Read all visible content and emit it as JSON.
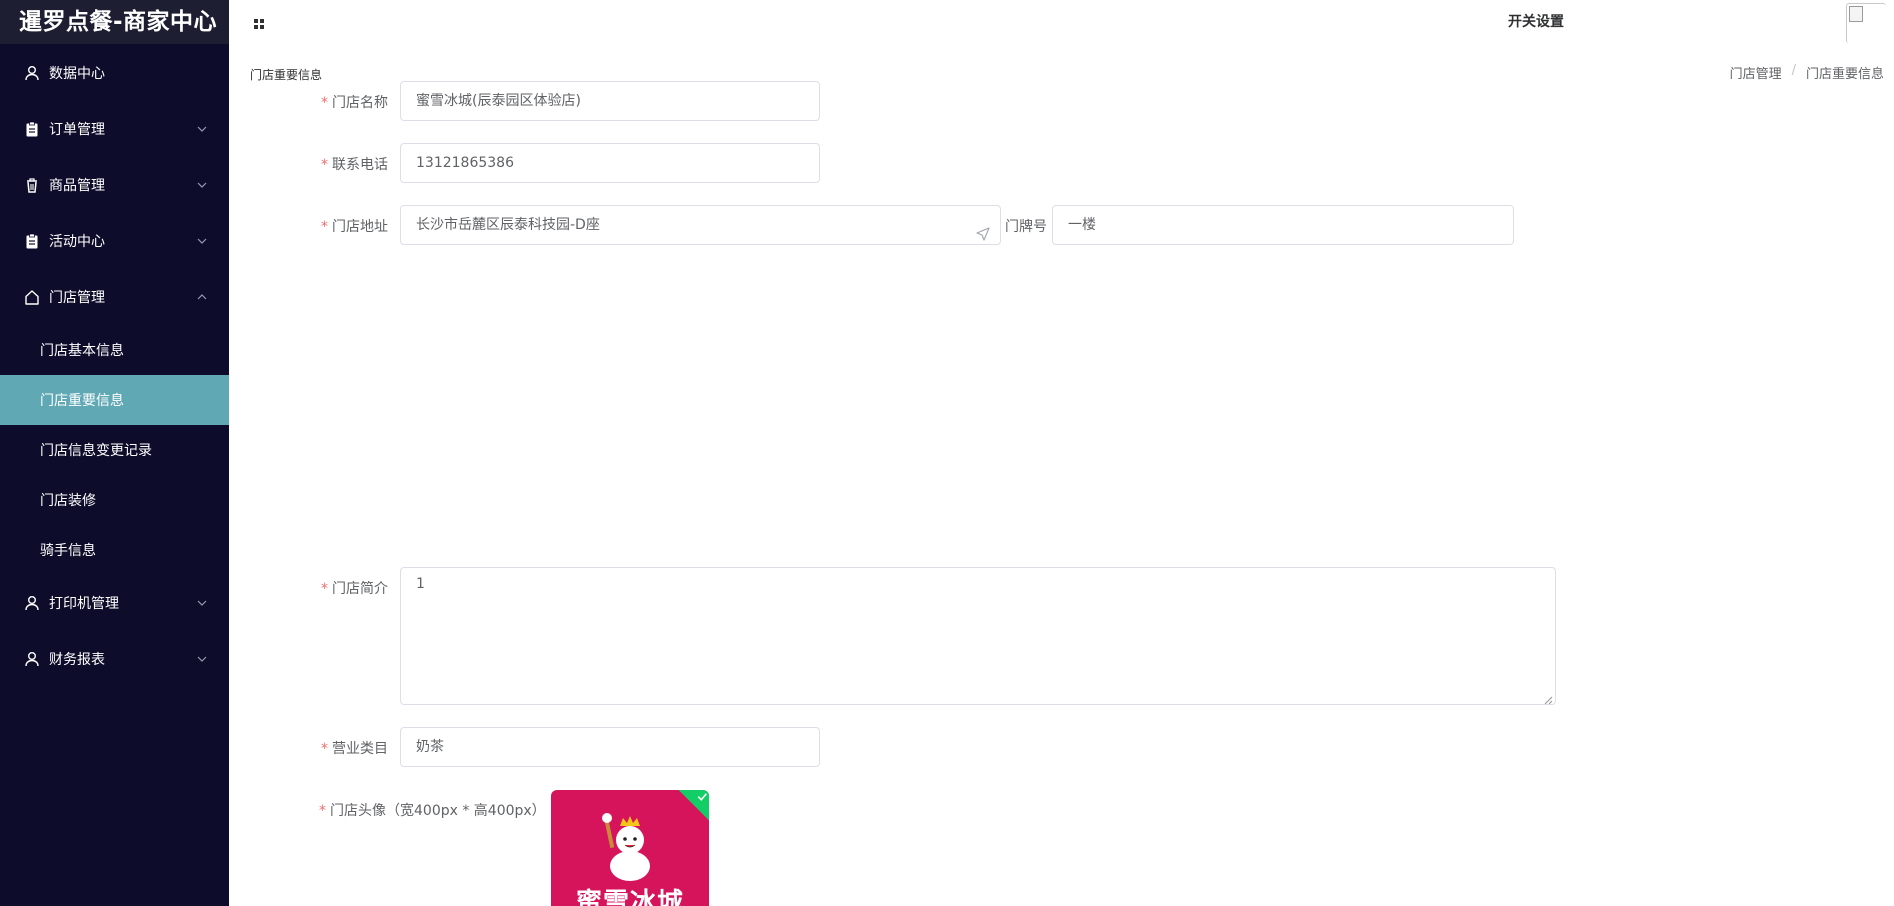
{
  "app": {
    "title": "暹罗点餐-商家中心"
  },
  "header": {
    "title": "开关设置"
  },
  "sidebar": {
    "items": [
      {
        "label": "数据中心",
        "icon": "user-icon"
      },
      {
        "label": "订单管理",
        "icon": "clipboard-icon"
      },
      {
        "label": "商品管理",
        "icon": "trash-icon"
      },
      {
        "label": "活动中心",
        "icon": "clipboard-icon"
      },
      {
        "label": "门店管理",
        "icon": "home-icon"
      },
      {
        "label": "打印机管理",
        "icon": "user-icon"
      },
      {
        "label": "财务报表",
        "icon": "user-icon"
      }
    ],
    "subitems": [
      {
        "label": "门店基本信息"
      },
      {
        "label": "门店重要信息"
      },
      {
        "label": "门店信息变更记录"
      },
      {
        "label": "门店装修"
      },
      {
        "label": "骑手信息"
      }
    ],
    "active_color": "#5fa8b4",
    "background": "#0d0d2b"
  },
  "page": {
    "label": "门店重要信息"
  },
  "breadcrumb": {
    "items": [
      "门店管理",
      "门店重要信息"
    ],
    "separator": "/"
  },
  "form": {
    "required_mark": "*",
    "store_name": {
      "label": "门店名称",
      "value": "蜜雪冰城(辰泰园区体验店)"
    },
    "phone": {
      "label": "联系电话",
      "value": "13121865386"
    },
    "address": {
      "label": "门店地址",
      "value": "长沙市岳麓区辰泰科技园-D座"
    },
    "door_no": {
      "label": "门牌号",
      "value": "一楼"
    },
    "intro": {
      "label": "门店简介",
      "value": "1"
    },
    "category": {
      "label": "营业类目",
      "value": "奶茶"
    },
    "avatar": {
      "label": "门店头像（宽400px * 高400px）",
      "image_text": "蜜雪冰城"
    }
  }
}
